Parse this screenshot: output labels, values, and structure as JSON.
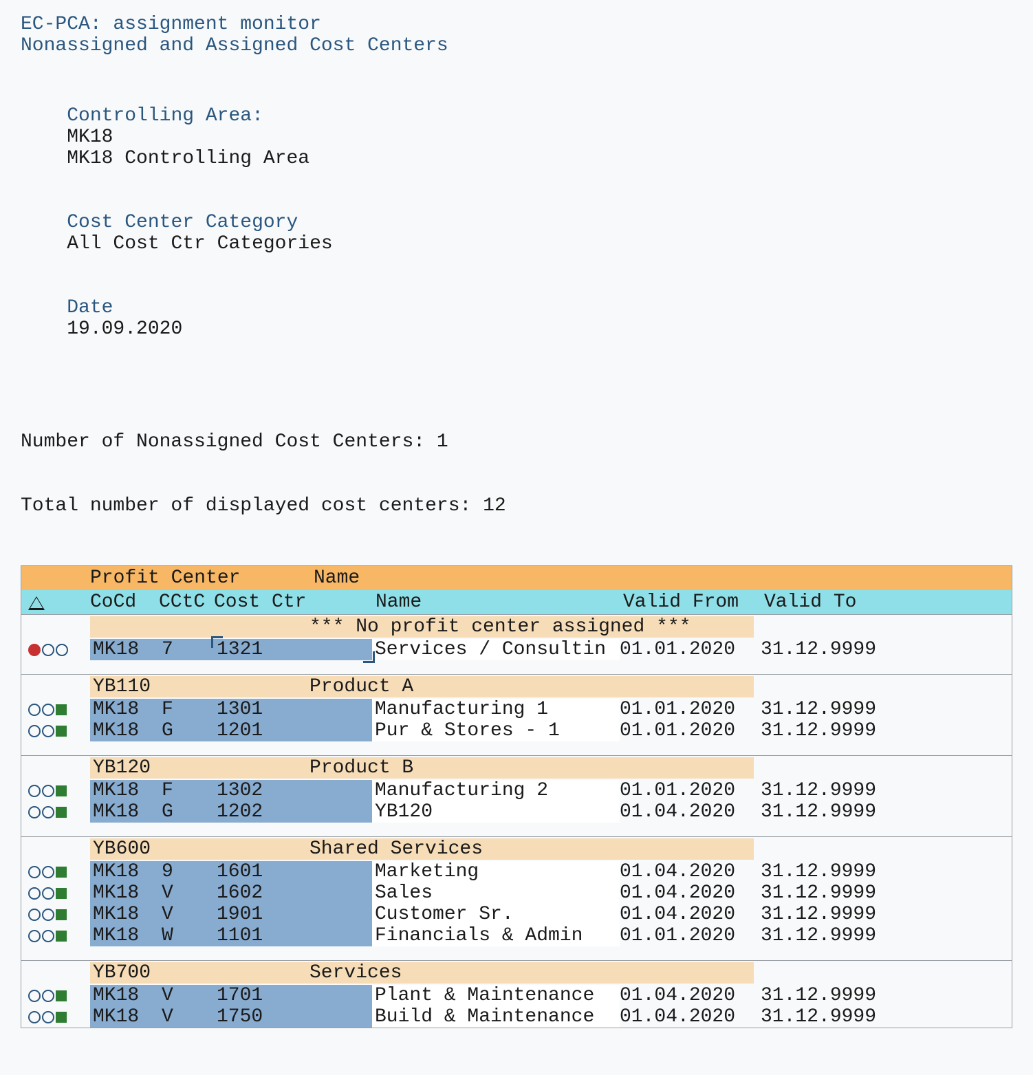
{
  "title": "EC-PCA: assignment monitor",
  "subtitle": "Nonassigned and Assigned Cost Centers",
  "meta": {
    "controlling_area_label": "Controlling Area:",
    "controlling_area_value": "MK18",
    "controlling_area_desc": "MK18 Controlling Area",
    "cost_center_cat_label": "Cost Center Category",
    "cost_center_cat_value": "All Cost Ctr Categories",
    "date_label": "Date",
    "date_value": "19.09.2020"
  },
  "counts": {
    "nonassigned_text": "Number of Nonassigned Cost Centers: 1",
    "displayed_text": "Total number of displayed cost centers: 12"
  },
  "headers": {
    "profit_center": "Profit Center",
    "pc_name": "Name",
    "warn_icon": "warning-triangle-icon",
    "cocd": "CoCd",
    "cctc": "CCtC",
    "cost_ctr": "Cost Ctr",
    "cc_name": "Name",
    "valid_from": "Valid From",
    "valid_to": "Valid To"
  },
  "groups": [
    {
      "profit_center": "",
      "pc_name": "*** No profit center assigned ***",
      "rows": [
        {
          "status": "red",
          "selected": true,
          "cocd": "MK18",
          "cctc": "7",
          "cost_ctr": "1321",
          "name": "Services / Consultin",
          "valid_from": "01.01.2020",
          "valid_to": "31.12.9999"
        }
      ]
    },
    {
      "profit_center": "YB110",
      "pc_name": "Product A",
      "rows": [
        {
          "status": "green",
          "cocd": "MK18",
          "cctc": "F",
          "cost_ctr": "1301",
          "name": "Manufacturing 1",
          "valid_from": "01.01.2020",
          "valid_to": "31.12.9999"
        },
        {
          "status": "green",
          "cocd": "MK18",
          "cctc": "G",
          "cost_ctr": "1201",
          "name": "Pur & Stores - 1",
          "valid_from": "01.01.2020",
          "valid_to": "31.12.9999"
        }
      ]
    },
    {
      "profit_center": "YB120",
      "pc_name": "Product B",
      "rows": [
        {
          "status": "green",
          "cocd": "MK18",
          "cctc": "F",
          "cost_ctr": "1302",
          "name": "Manufacturing 2",
          "valid_from": "01.01.2020",
          "valid_to": "31.12.9999"
        },
        {
          "status": "green",
          "cocd": "MK18",
          "cctc": "G",
          "cost_ctr": "1202",
          "name": "YB120",
          "valid_from": "01.04.2020",
          "valid_to": "31.12.9999"
        }
      ]
    },
    {
      "profit_center": "YB600",
      "pc_name": "Shared Services",
      "rows": [
        {
          "status": "green",
          "cocd": "MK18",
          "cctc": "9",
          "cost_ctr": "1601",
          "name": "Marketing",
          "valid_from": "01.04.2020",
          "valid_to": "31.12.9999"
        },
        {
          "status": "green",
          "cocd": "MK18",
          "cctc": "V",
          "cost_ctr": "1602",
          "name": "Sales",
          "valid_from": "01.04.2020",
          "valid_to": "31.12.9999"
        },
        {
          "status": "green",
          "cocd": "MK18",
          "cctc": "V",
          "cost_ctr": "1901",
          "name": "Customer Sr.",
          "valid_from": "01.04.2020",
          "valid_to": "31.12.9999"
        },
        {
          "status": "green",
          "cocd": "MK18",
          "cctc": "W",
          "cost_ctr": "1101",
          "name": "Financials & Admin",
          "valid_from": "01.01.2020",
          "valid_to": "31.12.9999"
        }
      ]
    },
    {
      "profit_center": "YB700",
      "pc_name": "Services",
      "rows": [
        {
          "status": "green",
          "cocd": "MK18",
          "cctc": "V",
          "cost_ctr": "1701",
          "name": "Plant & Maintenance",
          "valid_from": "01.04.2020",
          "valid_to": "31.12.9999"
        },
        {
          "status": "green",
          "cocd": "MK18",
          "cctc": "V",
          "cost_ctr": "1750",
          "name": "Build & Maintenance",
          "valid_from": "01.04.2020",
          "valid_to": "31.12.9999"
        }
      ]
    }
  ]
}
